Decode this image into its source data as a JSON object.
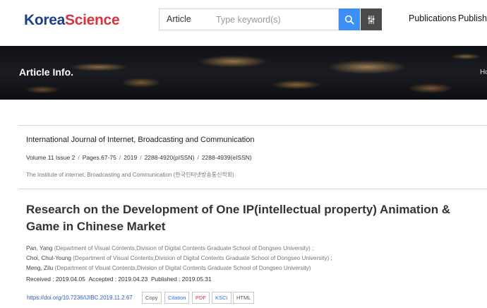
{
  "header": {
    "logo_part1": "Korea",
    "logo_part2": "Science",
    "search_select": "Article",
    "search_placeholder": "Type keyword(s)",
    "nav": [
      "Publications",
      "Publishe"
    ]
  },
  "banner": {
    "title": "Article Info.",
    "crumb": "Ho"
  },
  "journal": {
    "name": "International Journal of Internet, Broadcasting and Communication",
    "volume": "Volume 11 Issue 2",
    "pages": "Pages.67-75",
    "year": "2019",
    "pissn": "2288-4920(pISSN)",
    "eissn": "2288-4939(eISSN)",
    "publisher": "The Institute of internet, Broadcasting and Communication (한국인터넷방송통신학회)"
  },
  "article": {
    "title": "Research on the Development of One IP(intellectual property) Animation & Game in Chinese Market",
    "authors": [
      {
        "name": "Pan, Yang",
        "affiliation": "(Department of Visual Contents,Division of Digital Contents Graduate School of Dongseo University) ;"
      },
      {
        "name": "Choi, Chul-Young",
        "affiliation": "(Department of Visual Contents,Division of Digital Contents Graduate School of Dongseo University) ;"
      },
      {
        "name": "Meng, Zilu",
        "affiliation": "(Department of Visual Contents,Division of Digital Contents Graduate School of Dongseo University)"
      }
    ],
    "received": "Received : 2019.04.05",
    "accepted": "Accepted : 2019.04.23",
    "published": "Published : 2019.05.31",
    "doi": "https://doi.org/10.7236/IJIBC.2019.11.2.67",
    "buttons": {
      "copy": "Copy",
      "citation": "Citation",
      "pdf": "PDF",
      "ksci": "KSCI",
      "html": "HTML"
    }
  },
  "colors": {
    "logo_blue": "#1c3f8c",
    "logo_red": "#d9333f",
    "search_button": "#3d8ff5",
    "filter_button": "#4b4b4b",
    "link": "#2d5bb7",
    "pdf_red": "#d9333f",
    "citation_blue": "#2d6fd6"
  },
  "icons": [
    "search-icon",
    "filter-icon"
  ]
}
